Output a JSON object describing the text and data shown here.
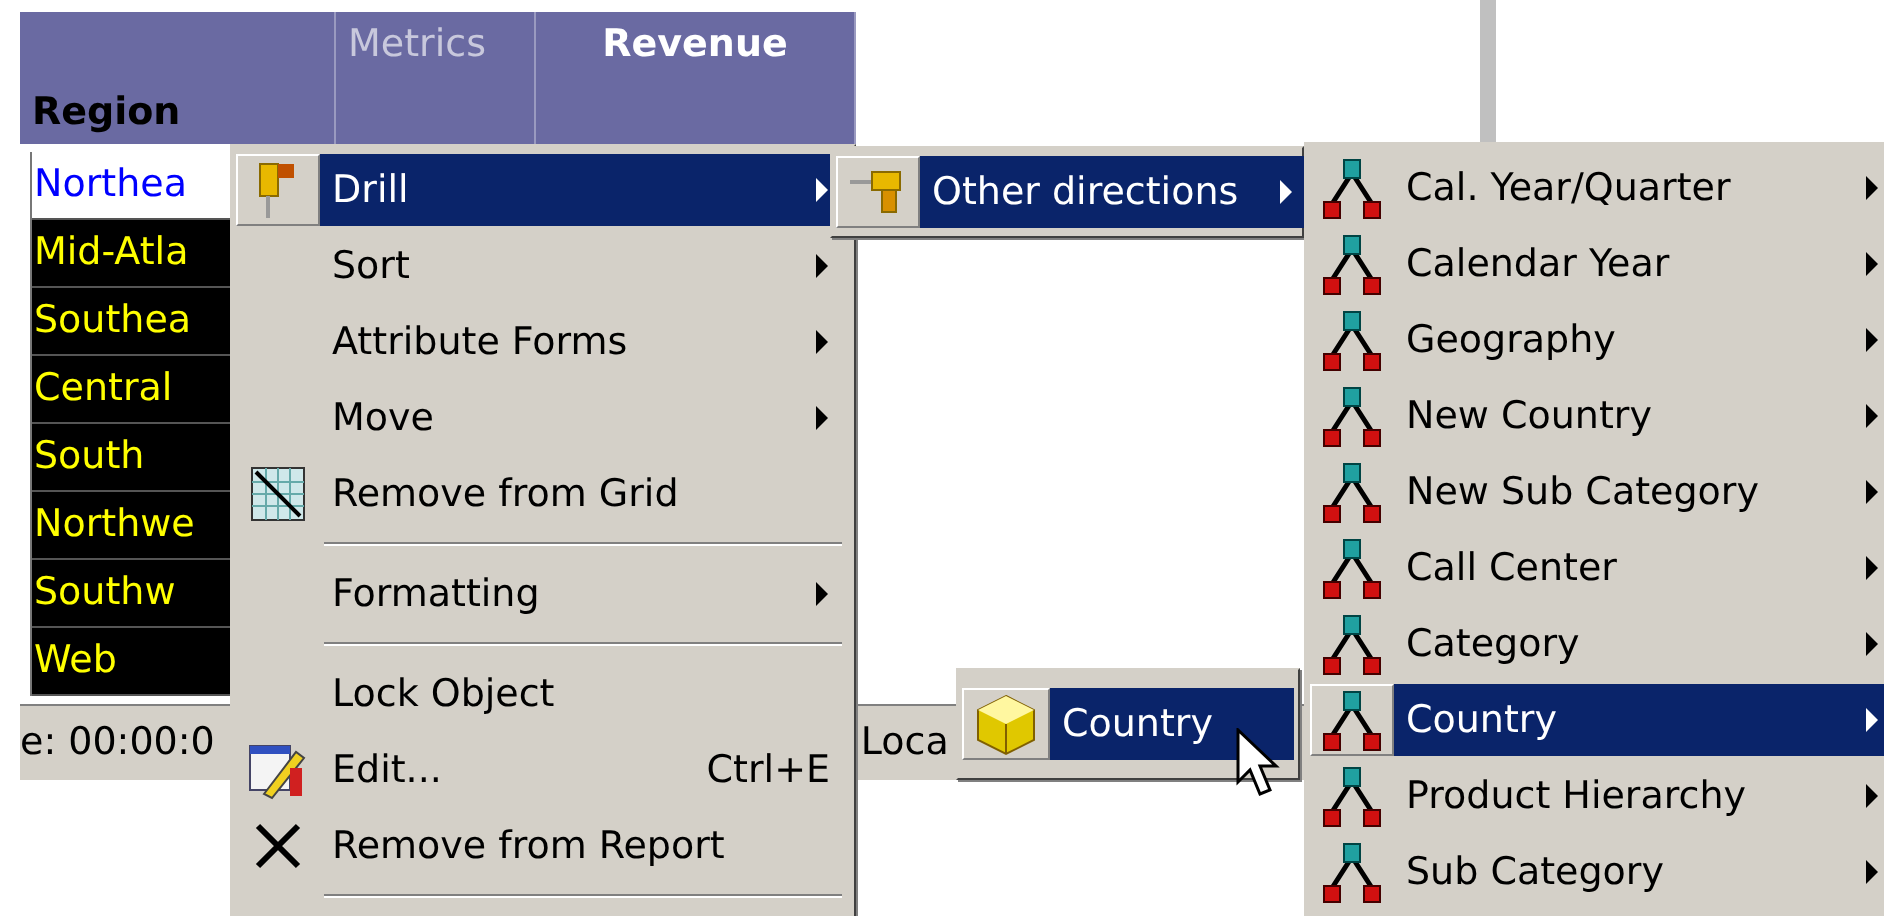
{
  "grid": {
    "columns": [
      {
        "kind": "attribute",
        "label": "Region"
      },
      {
        "kind": "group",
        "label": "Metrics"
      },
      {
        "kind": "metric",
        "label": "Revenue"
      }
    ],
    "rows": [
      {
        "label": "Northea",
        "selected": true
      },
      {
        "label": "Mid-Atla",
        "selected": false
      },
      {
        "label": "Southea",
        "selected": false
      },
      {
        "label": "Central",
        "selected": false
      },
      {
        "label": "South",
        "selected": false
      },
      {
        "label": "Northwe",
        "selected": false
      },
      {
        "label": "Southw",
        "selected": false
      },
      {
        "label": "Web",
        "selected": false
      }
    ]
  },
  "status_bar": {
    "items": [
      "e: 00:00:0",
      "Loca"
    ]
  },
  "context_menu": {
    "items": [
      {
        "kind": "drill",
        "label": "Drill",
        "submenu": true,
        "selected": true
      },
      {
        "kind": "plain",
        "label": "Sort",
        "submenu": true,
        "selected": false
      },
      {
        "kind": "plain",
        "label": "Attribute Forms",
        "submenu": true,
        "selected": false
      },
      {
        "kind": "plain",
        "label": "Move",
        "submenu": true,
        "selected": false
      },
      {
        "kind": "grid",
        "label": "Remove from Grid",
        "submenu": false,
        "selected": false
      },
      {
        "kind": "separator"
      },
      {
        "kind": "plain",
        "label": "Formatting",
        "submenu": true,
        "selected": false
      },
      {
        "kind": "separator"
      },
      {
        "kind": "plain",
        "label": "Lock Object",
        "submenu": false,
        "selected": false
      },
      {
        "kind": "edit",
        "label": "Edit...",
        "shortcut": "Ctrl+E",
        "submenu": false,
        "selected": false
      },
      {
        "kind": "delete",
        "label": "Remove from Report",
        "submenu": false,
        "selected": false
      },
      {
        "kind": "separator"
      }
    ]
  },
  "drill_menu": {
    "items": [
      {
        "kind": "drill-other",
        "label": "Other directions",
        "submenu": true,
        "selected": true
      }
    ]
  },
  "attribute_menu": {
    "items": [
      {
        "kind": "attribute",
        "label": "Country",
        "submenu": false,
        "selected": true
      }
    ]
  },
  "directions_menu": {
    "items": [
      {
        "kind": "hierarchy",
        "label": "Cal. Year/Quarter",
        "submenu": true,
        "selected": false
      },
      {
        "kind": "hierarchy",
        "label": "Calendar Year",
        "submenu": true,
        "selected": false
      },
      {
        "kind": "hierarchy",
        "label": "Geography",
        "submenu": true,
        "selected": false
      },
      {
        "kind": "hierarchy",
        "label": "New Country",
        "submenu": true,
        "selected": false
      },
      {
        "kind": "hierarchy",
        "label": "New Sub Category",
        "submenu": true,
        "selected": false
      },
      {
        "kind": "hierarchy",
        "label": "Call Center",
        "submenu": true,
        "selected": false
      },
      {
        "kind": "hierarchy",
        "label": "Category",
        "submenu": true,
        "selected": false
      },
      {
        "kind": "hierarchy",
        "label": "Country",
        "submenu": true,
        "selected": true
      },
      {
        "kind": "hierarchy",
        "label": "Product Hierarchy",
        "submenu": true,
        "selected": false
      },
      {
        "kind": "hierarchy",
        "label": "Sub Category",
        "submenu": true,
        "selected": false
      }
    ]
  }
}
